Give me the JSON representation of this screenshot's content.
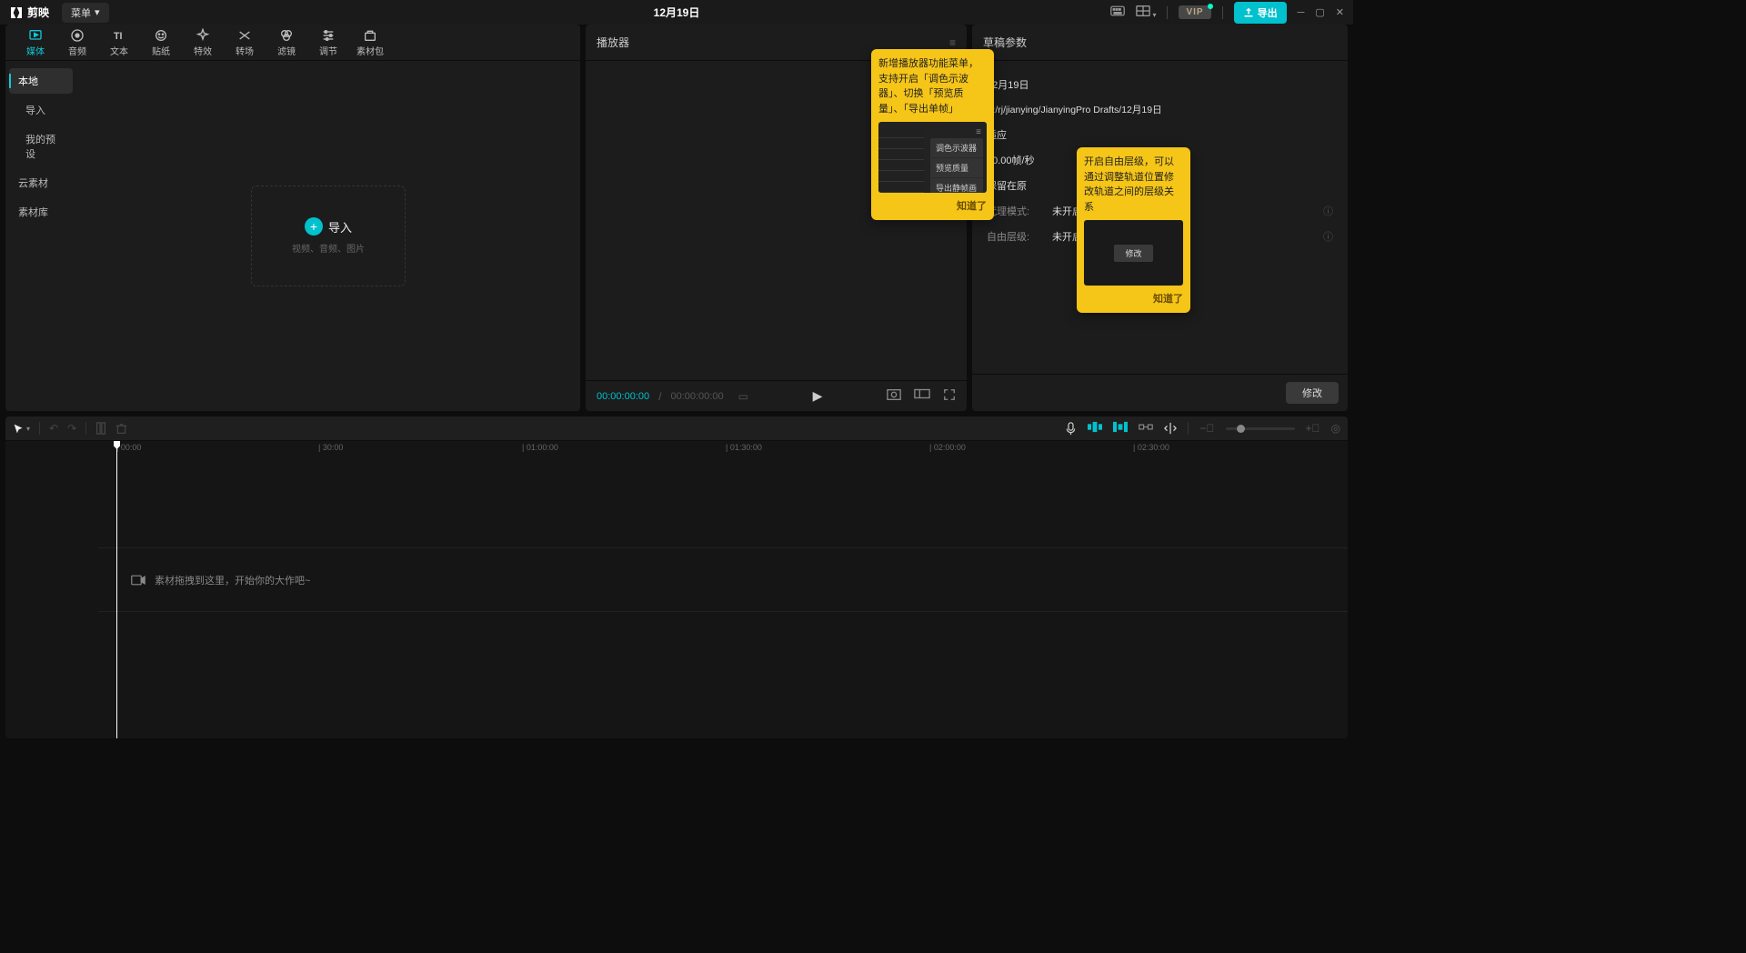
{
  "titlebar": {
    "app_name": "剪映",
    "menu_label": "菜单",
    "project_title": "12月19日",
    "vip_label": "VIP",
    "export_label": "导出"
  },
  "toptabs": [
    {
      "label": "媒体"
    },
    {
      "label": "音频"
    },
    {
      "label": "文本"
    },
    {
      "label": "贴纸"
    },
    {
      "label": "特效"
    },
    {
      "label": "转场"
    },
    {
      "label": "滤镜"
    },
    {
      "label": "调节"
    },
    {
      "label": "素材包"
    }
  ],
  "media_sidebar": {
    "items": [
      {
        "label": "本地",
        "active": true
      },
      {
        "label": "导入",
        "sub": true
      },
      {
        "label": "我的预设",
        "sub": true
      },
      {
        "label": "云素材"
      },
      {
        "label": "素材库"
      }
    ]
  },
  "import_box": {
    "title": "导入",
    "subtitle": "视频、音频、图片"
  },
  "player": {
    "title": "播放器",
    "tc_current": "00:00:00:00",
    "tc_total": "00:00:00:00"
  },
  "tooltip1": {
    "text": "新增播放器功能菜单，支持开启「调色示波器」、切换「预览质量」、「导出单帧」",
    "menu_items": [
      "调色示波器",
      "预览质量",
      "导出静帧画面"
    ],
    "ok": "知道了"
  },
  "tooltip2": {
    "text": "开启自由层级，可以通过调整轨道位置修改轨道之间的层级关系",
    "btn": "修改",
    "ok": "知道了"
  },
  "props": {
    "title": "草稿参数",
    "rows": [
      {
        "label": "",
        "value": "12月19日"
      },
      {
        "label": "",
        "value": "F:/rj/jianying/JianyingPro Drafts/12月19日"
      },
      {
        "label": "",
        "value": "适应"
      },
      {
        "label": "",
        "value": "30.00帧/秒"
      },
      {
        "label": "",
        "value": "保留在原"
      },
      {
        "label": "代理模式:",
        "value": "未开启",
        "icon": true
      },
      {
        "label": "自由层级:",
        "value": "未开启",
        "icon": true
      }
    ],
    "modify": "修改"
  },
  "ruler_marks": [
    {
      "pos": 122,
      "label": "00:00"
    },
    {
      "pos": 344,
      "label": "30:00"
    },
    {
      "pos": 568,
      "label": "01:00:00"
    },
    {
      "pos": 792,
      "label": "01:30:00"
    },
    {
      "pos": 1016,
      "label": "02:00:00"
    },
    {
      "pos": 1240,
      "label": "02:30:00"
    }
  ],
  "timeline_empty": "素材拖拽到这里，开始你的大作吧~"
}
